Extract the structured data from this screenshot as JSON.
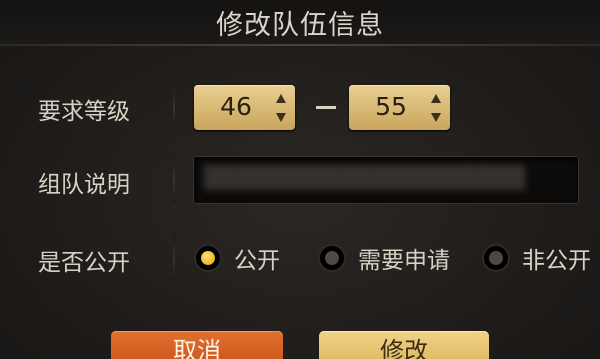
{
  "dialog": {
    "title": "修改队伍信息"
  },
  "level": {
    "label": "要求等级",
    "min": "46",
    "max": "55",
    "separator": "—"
  },
  "description": {
    "label": "组队说明",
    "value": "▒▒▒▒▒▒▒▒▒▒▒▒▒▒▒▒▒▒▒"
  },
  "visibility": {
    "label": "是否公开",
    "options": [
      {
        "label": "公开",
        "selected": true
      },
      {
        "label": "需要申请",
        "selected": false
      },
      {
        "label": "非公开",
        "selected": false
      }
    ]
  },
  "buttons": {
    "cancel": "取消",
    "modify": "修改"
  },
  "colors": {
    "accent_gold": "#e9cf90",
    "cancel_orange": "#d95f22",
    "radio_selected": "#f0b320"
  }
}
